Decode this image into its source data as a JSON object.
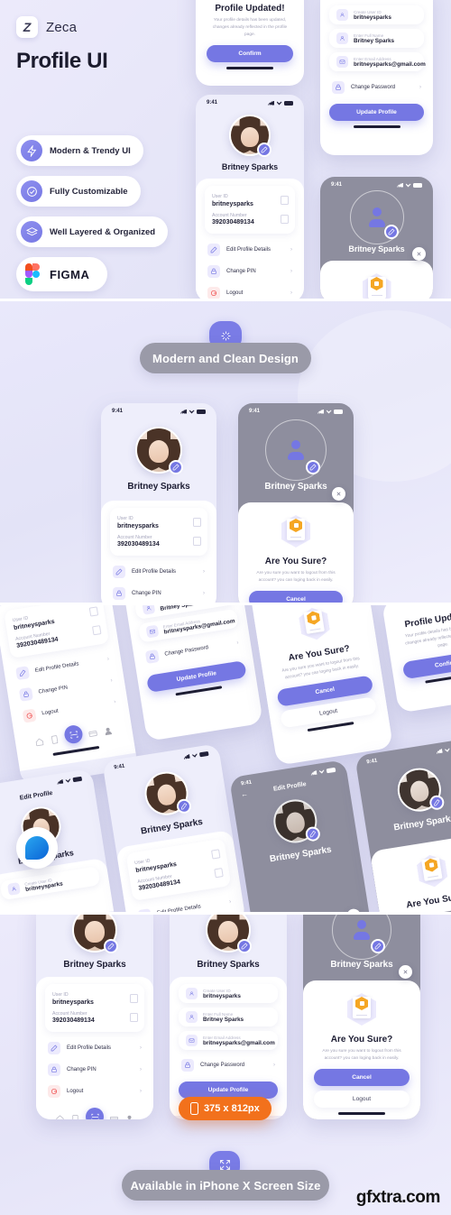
{
  "brand": {
    "logo_letter": "Z",
    "name": "Zeca",
    "title": "Profile UI",
    "features": [
      {
        "label": "Modern & Trendy UI",
        "icon": "bolt-icon"
      },
      {
        "label": "Fully Customizable",
        "icon": "check-circle-icon"
      },
      {
        "label": "Well Layered & Organized",
        "icon": "layers-icon"
      }
    ],
    "figma_label": "FIGMA"
  },
  "banners": {
    "modern": {
      "text": "Modern and Clean Design",
      "icon": "sparkle-icon"
    },
    "iphone": {
      "text": "Available in iPhone X Screen Size",
      "icon": "resize-icon"
    },
    "size_badge": {
      "text": "375 x 812px",
      "icon": "phone-icon"
    }
  },
  "status_bar": {
    "time": "9:41",
    "signal": "signal-icon",
    "wifi": "wifi-icon",
    "battery": "battery-icon"
  },
  "profile": {
    "name": "Britney Sparks",
    "user_id_label": "User ID",
    "user_id_value": "britneysparks",
    "account_label": "Account Number",
    "account_value": "392030489134",
    "menu": [
      {
        "label": "Edit Profile Details",
        "icon": "pencil-icon"
      },
      {
        "label": "Change PIN",
        "icon": "lock-icon"
      },
      {
        "label": "Logout",
        "icon": "logout-icon"
      }
    ],
    "chevron": "›"
  },
  "tabbar": {
    "items": [
      "home-icon",
      "document-icon",
      "scan-icon",
      "card-icon",
      "person-icon"
    ]
  },
  "edit_profile": {
    "nav_title": "Edit Profile",
    "back": "←",
    "fields": [
      {
        "label": "Create User ID",
        "value": "britneysparks",
        "icon": "id-icon"
      },
      {
        "label": "Enter Full Name",
        "value": "Britney Sparks",
        "icon": "person-icon"
      },
      {
        "label": "Enter Email Address",
        "value": "britneysparks@gmail.com",
        "icon": "mail-icon"
      }
    ],
    "change_password": {
      "label": "Change Password",
      "icon": "lock-icon",
      "chevron": "›"
    },
    "submit": "Update Profile"
  },
  "logout_modal": {
    "title": "Are You Sure?",
    "body": "Are you sure you want to logout from this account? you can loging back in easily.",
    "primary": "Cancel",
    "secondary": "Logout",
    "close": "close-icon"
  },
  "updated_modal": {
    "title": "Profile Updated!",
    "body": "Your profile details has been updated, changes already reflected in the profile page.",
    "primary": "Confirm"
  },
  "watermark": "gfxtra.com",
  "colors": {
    "accent": "#7577e3",
    "background": "#e7e7f8",
    "banner": "#9a9aa8",
    "orange": "#f2711c",
    "danger": "#ef4444",
    "gold": "#f5a623"
  }
}
